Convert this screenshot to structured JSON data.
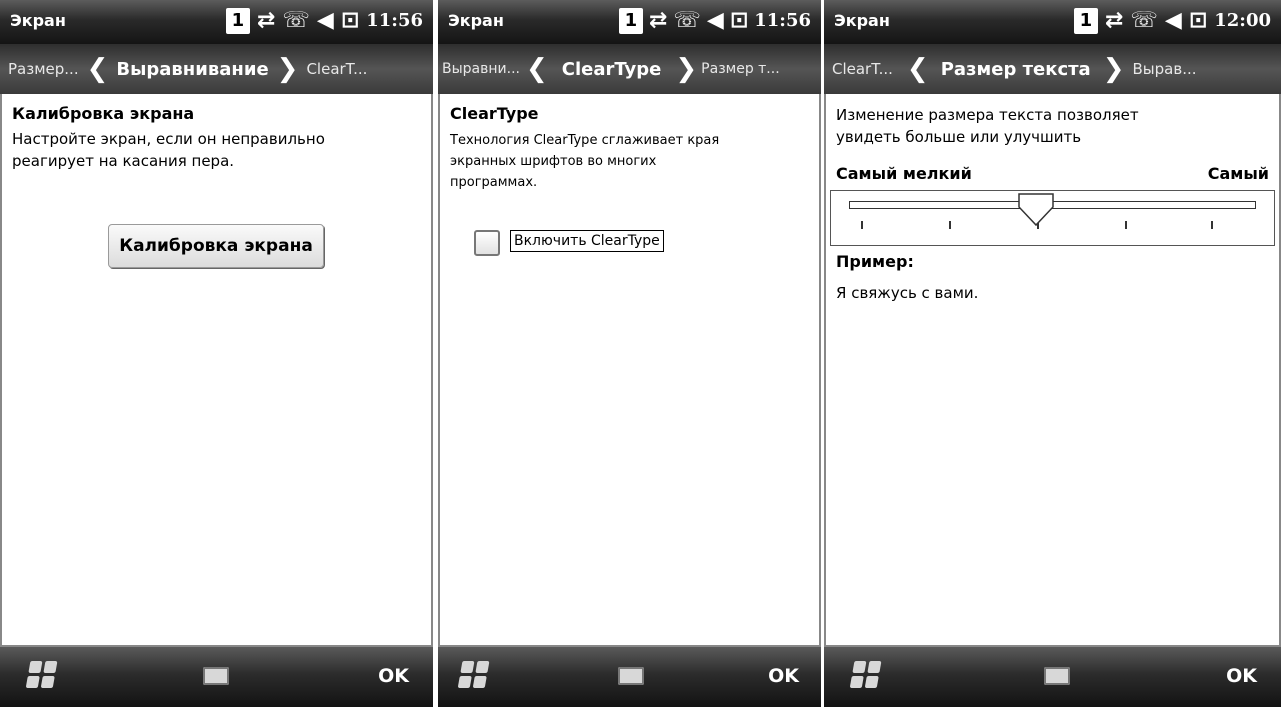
{
  "screens": [
    {
      "title": "Экран",
      "time": "11:56",
      "status_number": "1",
      "tab_prev": "Размер...",
      "tab_current": "Выравнивание",
      "tab_next": "ClearT...",
      "heading": "Калибровка экрана",
      "text_line1": "Настройте экран, если он неправильно",
      "text_line2": "реагирует на касания пера.",
      "button_label": "Калибровка экрана",
      "ok_label": "OK"
    },
    {
      "title": "Экран",
      "time": "11:56",
      "status_number": "1",
      "tab_prev": "Выравни...",
      "tab_current": "ClearType",
      "tab_next": "Размер т...",
      "heading": "ClearType",
      "text_line1": "Технология ClearType сглаживает края",
      "text_line2": "экранных шрифтов во многих",
      "text_line3": "программах.",
      "checkbox_label": "Включить ClearType",
      "checkbox_checked": false,
      "ok_label": "OK"
    },
    {
      "title": "Экран",
      "time": "12:00",
      "status_number": "1",
      "tab_prev": "ClearT...",
      "tab_current": "Размер текста",
      "tab_next": "Вырав...",
      "text_line1": "Изменение размера текста позволяет",
      "text_line2": "увидеть больше или улучшить",
      "slider_min_label": "Самый мелкий",
      "slider_max_label": "Самый",
      "slider_value": 0.5,
      "example_label": "Пример:",
      "example_text": "Я свяжусь с вами.",
      "ok_label": "OK"
    }
  ],
  "icons": [
    "windows-start-icon",
    "keyboard-icon",
    "connectivity-icon",
    "battery-icon",
    "volume-icon",
    "phone-icon"
  ]
}
